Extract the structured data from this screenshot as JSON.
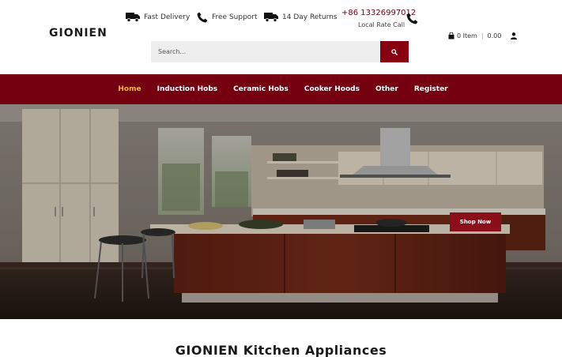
{
  "header": {
    "logo": "GIONIEN",
    "usps": [
      {
        "label": "Fast Delivery",
        "icon": "truck-icon"
      },
      {
        "label": "Free Support",
        "icon": "phone-icon"
      },
      {
        "label": "14 Day Returns",
        "icon": "truck-icon"
      }
    ],
    "phone": {
      "number": "+86 13326997012",
      "label": "Local Rate Call",
      "icon": "phone-icon"
    },
    "cart": {
      "count_label": "0 Item",
      "total": "0.00",
      "icon": "bag-icon",
      "user_icon": "user-icon"
    },
    "search": {
      "placeholder": "Search...",
      "button_icon": "search-icon"
    }
  },
  "nav": {
    "items": [
      {
        "label": "Home",
        "active": true
      },
      {
        "label": "Induction Hobs",
        "active": false
      },
      {
        "label": "Ceramic Hobs",
        "active": false
      },
      {
        "label": "Cooker Hoods",
        "active": false
      },
      {
        "label": "Other",
        "active": false
      },
      {
        "label": "Register",
        "active": false
      }
    ]
  },
  "hero": {
    "button_label": "Shop Now"
  },
  "section": {
    "title": "GIONIEN Kitchen Appliances"
  },
  "colors": {
    "brand": "#750010",
    "accent": "#f2b54a",
    "search_button": "#870012"
  }
}
